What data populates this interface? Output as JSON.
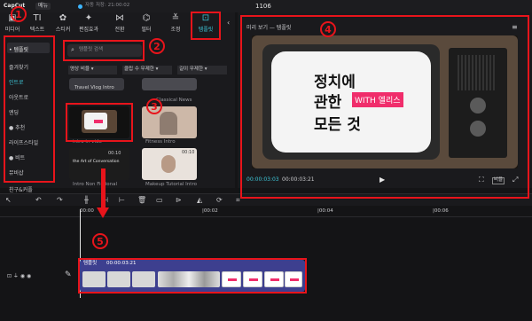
{
  "topbar": {
    "logo": "CapCut",
    "menu": "메뉴",
    "autosave": "자동 저장: 21:00:02",
    "project": "1106"
  },
  "toolbar": [
    {
      "icon": "▣",
      "label": "미디어"
    },
    {
      "icon": "TI",
      "label": "텍스트"
    },
    {
      "icon": "✿",
      "label": "스티커"
    },
    {
      "icon": "✦",
      "label": "편집효과"
    },
    {
      "icon": "⋈",
      "label": "전환"
    },
    {
      "icon": "⌬",
      "label": "필터"
    },
    {
      "icon": "≚",
      "label": "조정"
    },
    {
      "icon": "⊡",
      "label": "템플릿"
    }
  ],
  "sidebar": {
    "items": [
      "• 템플릿",
      "즐겨찾기",
      "인트로",
      "아웃트로",
      "엔딩",
      "● 추천",
      "라이프스타일",
      "● 비트",
      "뮤비샵",
      "친구&커플"
    ]
  },
  "search": {
    "placeholder": "템플릿 검색"
  },
  "filters": [
    "영상 비율 ▾",
    "클립 수 무제한 ▾",
    "길이 무제한 ▾"
  ],
  "templates": [
    {
      "label": "Travel Vlog Intro"
    },
    {
      "label": "Classical News"
    },
    {
      "label": "intro in vide"
    },
    {
      "label": "Fitness Intro"
    },
    {
      "label": "Intro Non Fictional"
    },
    {
      "label": "Makeup Tutorial Intro"
    }
  ],
  "thumb_texts": {
    "glimpse": "the Art of Conversation",
    "time1": "00:10",
    "time2": "00:10"
  },
  "preview": {
    "header": "미리 보기 — 템플릿",
    "line1": "정치에",
    "line2": "관한",
    "line3": "모든 것",
    "tag": "WITH 엘리스",
    "time_current": "00:00:03:03",
    "time_total": "00:00:03:21",
    "ratio": "비율"
  },
  "timeline": {
    "ticks": [
      "00:00",
      "|00:02",
      "|00:04",
      "|00:06"
    ],
    "track_label": "템플릿",
    "track_time": "00:00:03:21"
  },
  "badges": [
    "1",
    "2",
    "3",
    "4",
    "5"
  ]
}
